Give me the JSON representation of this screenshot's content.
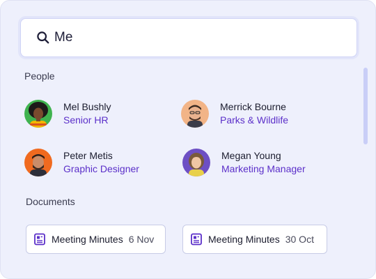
{
  "search": {
    "value": "Me",
    "icon": "search-icon"
  },
  "colors": {
    "accent": "#5b2fc9",
    "panel_bg": "#eef0fc",
    "input_border": "#cfd3f6"
  },
  "people": {
    "heading": "People",
    "items": [
      {
        "name": "Mel Bushly",
        "role": "Senior HR",
        "avatar_bg": "#3fb34f"
      },
      {
        "name": "Merrick Bourne",
        "role": "Parks & Wildlife",
        "avatar_bg": "#f2b487"
      },
      {
        "name": "Peter Metis",
        "role": "Graphic Designer",
        "avatar_bg": "#f06a1f"
      },
      {
        "name": "Megan Young",
        "role": "Marketing Manager",
        "avatar_bg": "#6d4fc4"
      }
    ]
  },
  "documents": {
    "heading": "Documents",
    "items": [
      {
        "title": "Meeting Minutes",
        "date": "6 Nov",
        "icon": "document-icon"
      },
      {
        "title": "Meeting Minutes",
        "date": "30 Oct",
        "icon": "document-icon"
      }
    ]
  }
}
